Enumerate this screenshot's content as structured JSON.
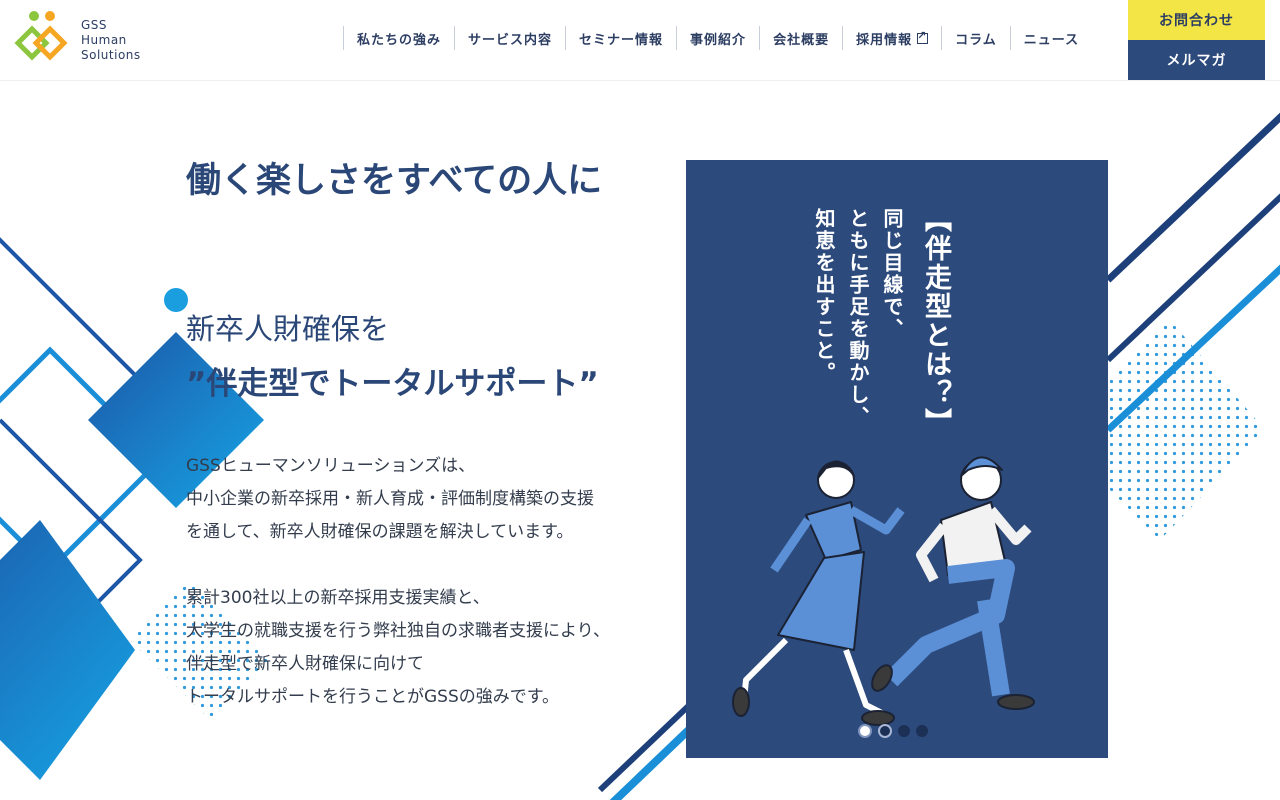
{
  "brand": {
    "line1": "GSS",
    "line2": "Human",
    "line3": "Solutions"
  },
  "nav": [
    {
      "label": "私たちの強み"
    },
    {
      "label": "サービス内容"
    },
    {
      "label": "セミナー情報"
    },
    {
      "label": "事例紹介"
    },
    {
      "label": "会社概要"
    },
    {
      "label": "採用情報",
      "icon": "external-link-icon"
    },
    {
      "label": "コラム"
    },
    {
      "label": "ニュース"
    }
  ],
  "cta": {
    "contact": "お問合わせ",
    "mailmag": "メルマガ"
  },
  "colors": {
    "navy": "#2c4a7c",
    "yellow": "#f4e546",
    "blue": "#1a8fd8",
    "logo_green": "#8cc63f",
    "logo_orange": "#f5a623"
  },
  "hero": {
    "title": "働く楽しさをすべての人に",
    "subtitle1": "新卒人財確保を",
    "subtitle2": "”伴走型でトータルサポート”",
    "body": {
      "p1": "GSSヒューマンソリューションズは、",
      "p2": "中小企業の新卒採用・新人育成・評価制度構築の支援",
      "p3": "を通して、新卒人財確保の課題を解決しています。",
      "p4": "累計300社以上の新卒採用支援実績と、",
      "p5": "大学生の就職支援を行う弊社独自の求職者支援により、",
      "p6": "伴走型で新卒人財確保に向けて",
      "p7": "トータルサポートを行うことがGSSの強みです。"
    }
  },
  "slide": {
    "col1": "【伴走型とは？】",
    "col2": "同じ目線で、",
    "col3": "ともに手足を動かし、",
    "col4": "知恵を出すこと。",
    "total": 4,
    "current": 1
  }
}
